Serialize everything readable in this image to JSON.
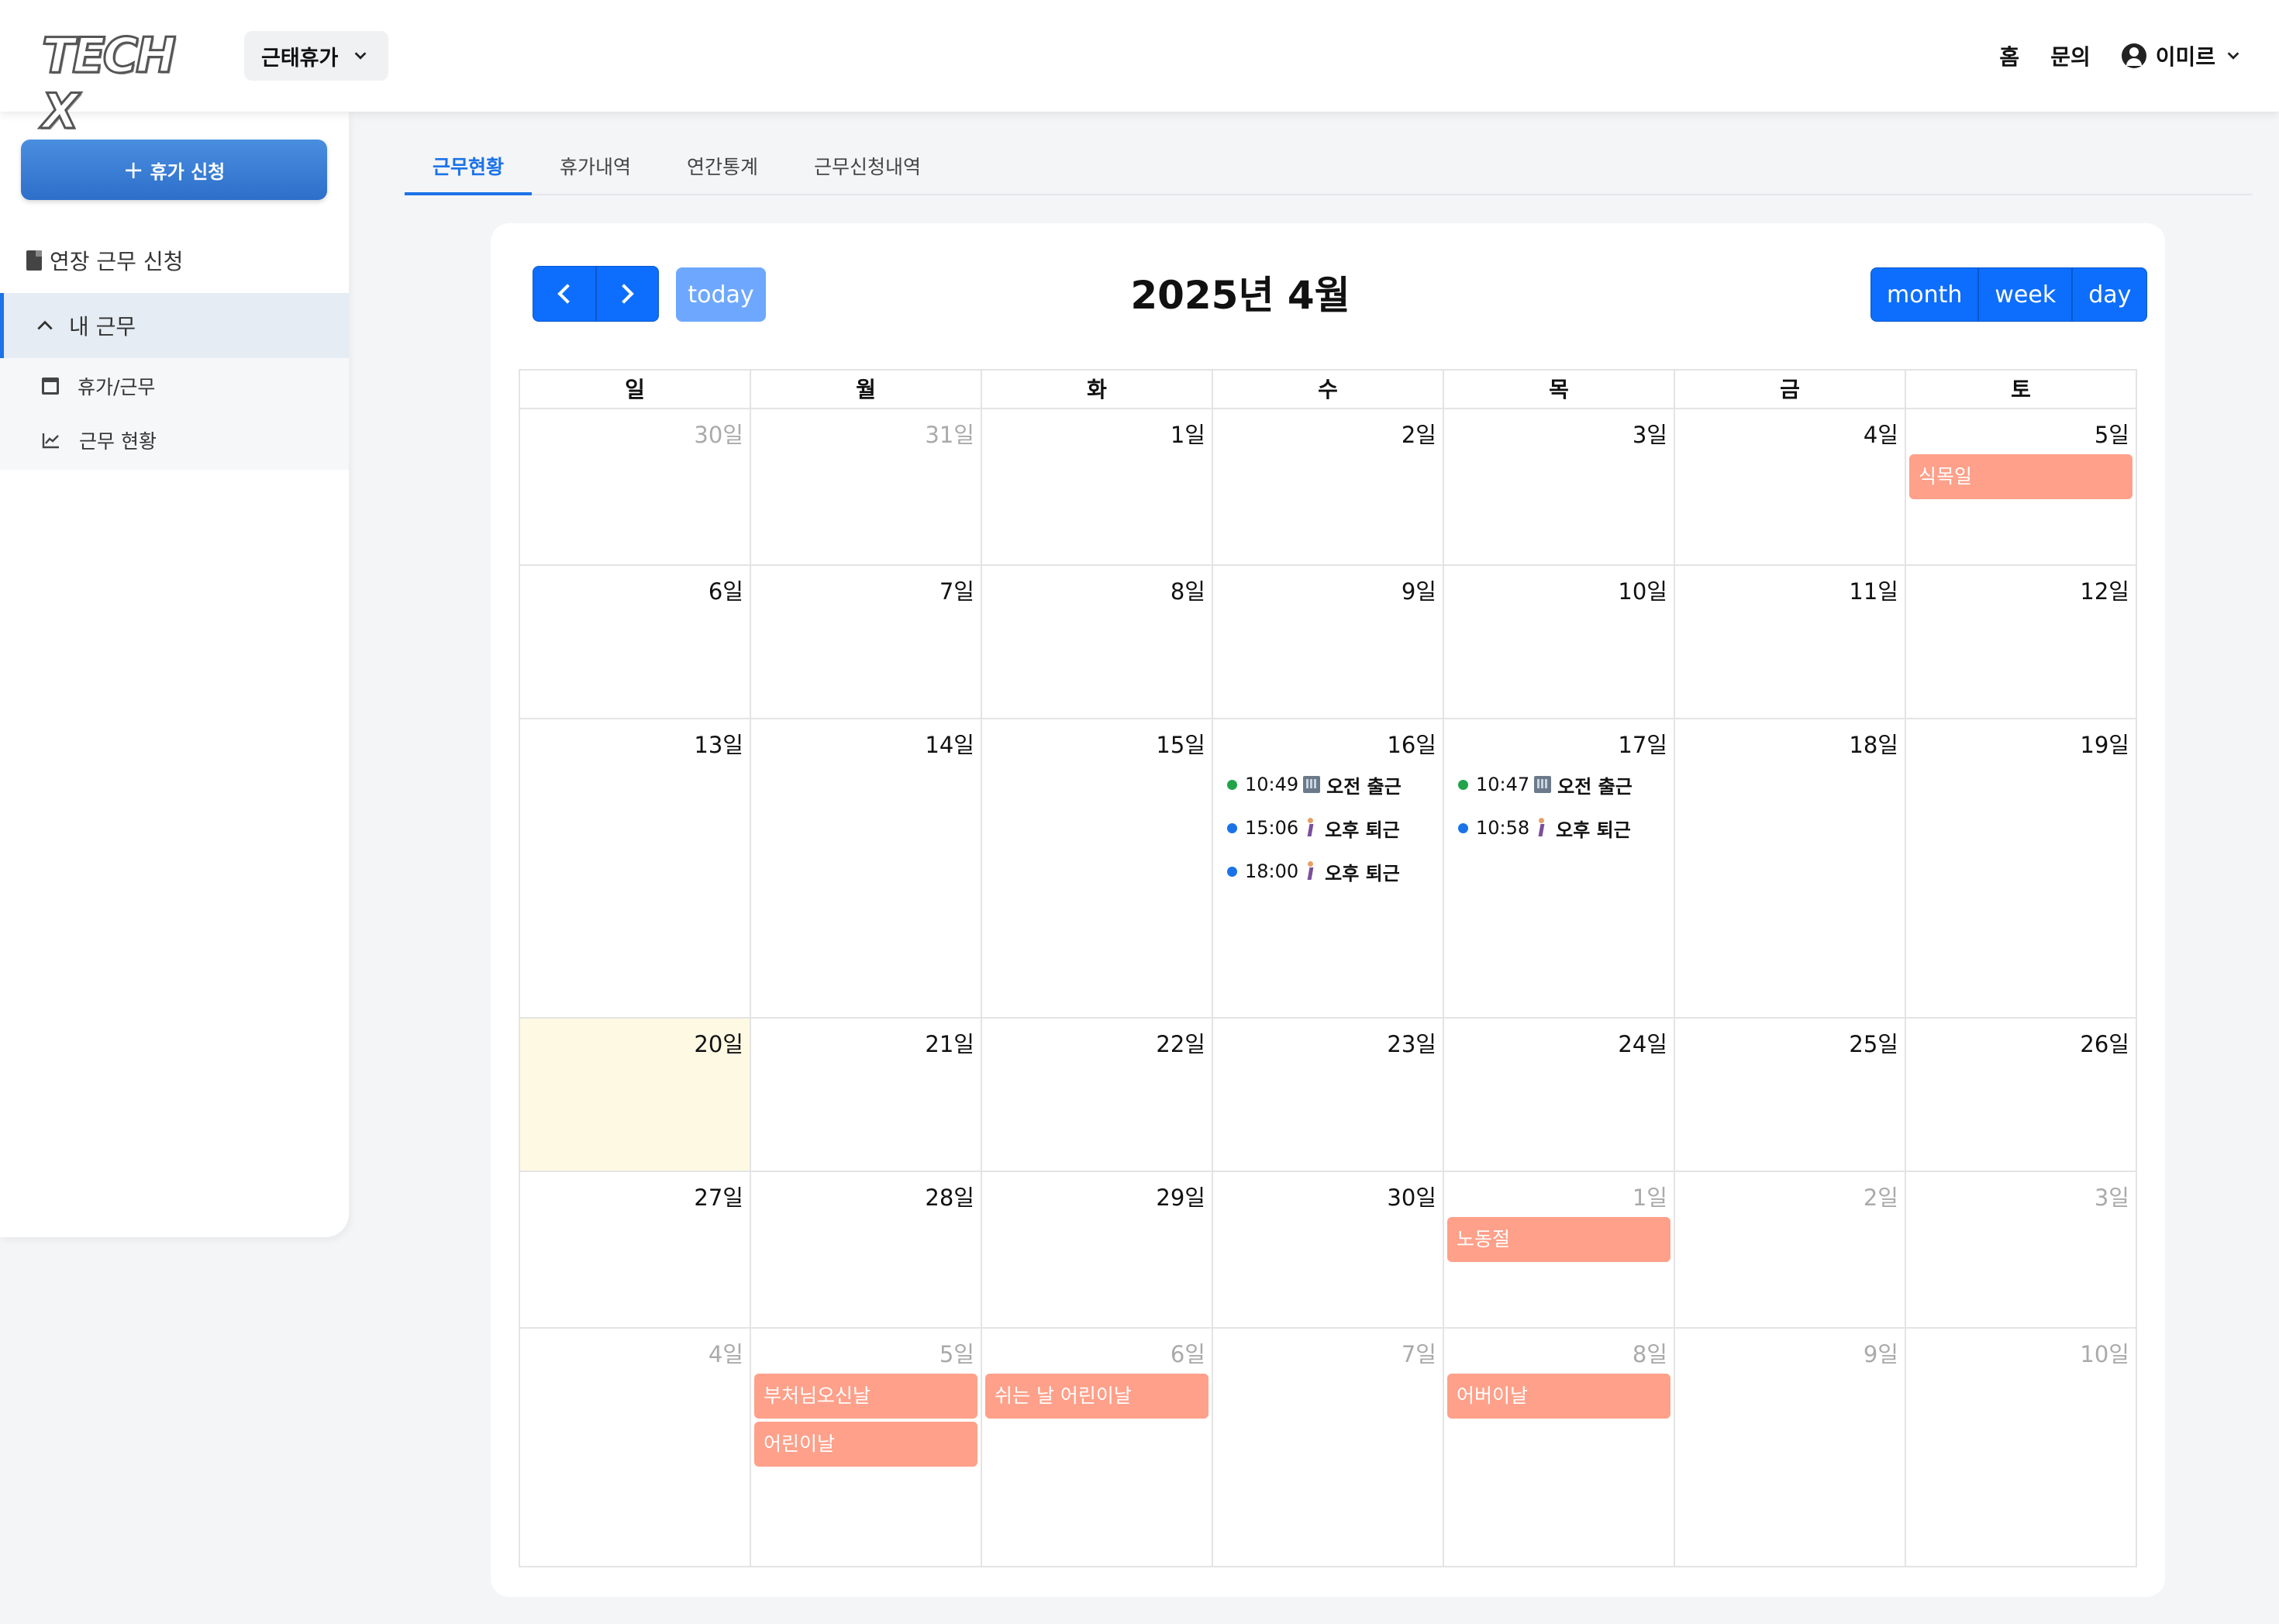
{
  "header": {
    "logo": "TECH X",
    "module": "근태휴가",
    "nav": {
      "home": "홈",
      "inquiry": "문의",
      "user": "이미르"
    }
  },
  "sidebar": {
    "leave_button": "휴가 신청",
    "overtime": "연장 근무 신청",
    "group": "내 근무",
    "items": [
      {
        "label": "휴가/근무",
        "icon": "calendar-icon"
      },
      {
        "label": "근무 현황",
        "icon": "line-chart-icon"
      }
    ]
  },
  "tabs": [
    "근무현황",
    "휴가내역",
    "연간통계",
    "근무신청내역"
  ],
  "calendar": {
    "title": "2025년 4월",
    "today_label": "today",
    "views": [
      "month",
      "week",
      "day"
    ],
    "weekdays": [
      "일",
      "월",
      "화",
      "수",
      "목",
      "금",
      "토"
    ],
    "weeks": [
      [
        {
          "label": "30일",
          "other": true
        },
        {
          "label": "31일",
          "other": true
        },
        {
          "label": "1일"
        },
        {
          "label": "2일"
        },
        {
          "label": "3일"
        },
        {
          "label": "4일"
        },
        {
          "label": "5일",
          "holidays": [
            "식목일"
          ]
        }
      ],
      [
        {
          "label": "6일"
        },
        {
          "label": "7일"
        },
        {
          "label": "8일"
        },
        {
          "label": "9일"
        },
        {
          "label": "10일"
        },
        {
          "label": "11일"
        },
        {
          "label": "12일"
        }
      ],
      [
        {
          "label": "13일"
        },
        {
          "label": "14일"
        },
        {
          "label": "15일"
        },
        {
          "label": "16일",
          "events": [
            {
              "time": "10:49",
              "label": "오전 출근",
              "dot": "#22a34a",
              "icon": "building-icon"
            },
            {
              "time": "15:06",
              "label": "오후 퇴근",
              "dot": "#1a73e8",
              "icon": "walking-person-icon"
            },
            {
              "time": "18:00",
              "label": "오후 퇴근",
              "dot": "#1a73e8",
              "icon": "walking-person-icon"
            }
          ]
        },
        {
          "label": "17일",
          "events": [
            {
              "time": "10:47",
              "label": "오전 출근",
              "dot": "#22a34a",
              "icon": "building-icon"
            },
            {
              "time": "10:58",
              "label": "오후 퇴근",
              "dot": "#1a73e8",
              "icon": "walking-person-icon"
            }
          ]
        },
        {
          "label": "18일"
        },
        {
          "label": "19일"
        }
      ],
      [
        {
          "label": "20일",
          "today": true
        },
        {
          "label": "21일"
        },
        {
          "label": "22일"
        },
        {
          "label": "23일"
        },
        {
          "label": "24일"
        },
        {
          "label": "25일"
        },
        {
          "label": "26일"
        }
      ],
      [
        {
          "label": "27일"
        },
        {
          "label": "28일"
        },
        {
          "label": "29일"
        },
        {
          "label": "30일"
        },
        {
          "label": "1일",
          "other": true,
          "holidays": [
            "노동절"
          ]
        },
        {
          "label": "2일",
          "other": true
        },
        {
          "label": "3일",
          "other": true
        }
      ],
      [
        {
          "label": "4일",
          "other": true
        },
        {
          "label": "5일",
          "other": true,
          "holidays": [
            "부처님오신날",
            "어린이날"
          ]
        },
        {
          "label": "6일",
          "other": true,
          "holidays": [
            "쉬는 날 어린이날"
          ]
        },
        {
          "label": "7일",
          "other": true
        },
        {
          "label": "8일",
          "other": true,
          "holidays": [
            "어버이날"
          ]
        },
        {
          "label": "9일",
          "other": true
        },
        {
          "label": "10일",
          "other": true
        }
      ]
    ]
  },
  "colors": {
    "accent": "#0d6efd",
    "holiday": "#fea08a",
    "today_bg": "#fef9e3"
  }
}
